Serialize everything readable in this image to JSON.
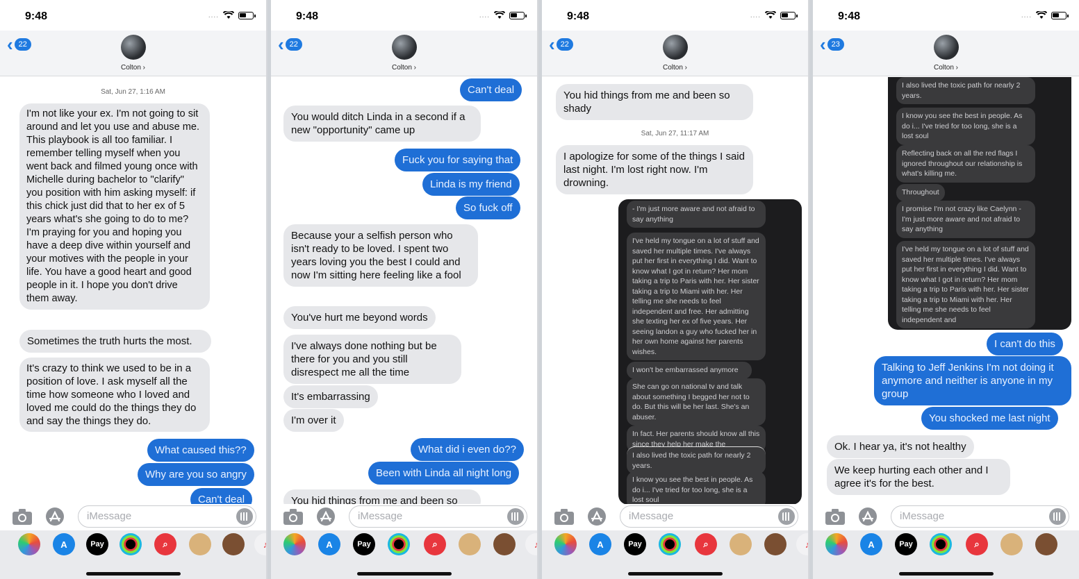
{
  "phones": [
    {
      "time": "9:48",
      "badge": "22",
      "contact": "Colton ›"
    },
    {
      "time": "9:48",
      "badge": "22",
      "contact": "Colton ›"
    },
    {
      "time": "9:48",
      "badge": "22",
      "contact": "Colton ›"
    },
    {
      "time": "9:48",
      "badge": "23",
      "contact": "Colton ›"
    }
  ],
  "input": {
    "placeholder": "iMessage"
  },
  "apps": {
    "pay": "Pay"
  },
  "status": {
    "dots": "...."
  },
  "p1": {
    "ts": "Sat, Jun 27, 1:16 AM",
    "m1": "I'm not like your ex. I'm not going to sit around and let you use and abuse me. This playbook is all too familiar. I remember telling myself when you went back and filmed young once with Michelle during bachelor to \"clarify\" you position with him asking myself: if this chick just did that to her ex of 5 years what's she going to do to me? I'm praying for you and hoping you have a deep dive within yourself and your motives with the people in your life. You have a good heart and good people in it. I hope you don't drive them away.",
    "m2": "Sometimes the truth hurts the most.",
    "m3": "It's crazy to think we used to be in a position of love. I ask myself all the time how someone who I loved and loved me could do the things they do and say the things they do.",
    "m4": "What caused this??",
    "m5": "Why are you so angry",
    "m6": "Can't deal"
  },
  "p2": {
    "m1": "Can't deal",
    "m2": "You would ditch Linda in a second if a new \"opportunity\" came up",
    "m3": "Fuck you for saying that",
    "m4": "Linda is my friend",
    "m5": "So fuck off",
    "m6": "Because your a selfish person who isn't ready to be loved. I spent two years loving you the best I could and now I'm sitting here feeling like a fool",
    "m7": "You've hurt me beyond words",
    "m8": "I've always done nothing but be there for you and you still disrespect me all the time",
    "m9": "It's embarrassing",
    "m10": "I'm over it",
    "m11": "What did i even do??",
    "m12": "Been with Linda all night long",
    "m13": "You hid things from me and been so"
  },
  "p3": {
    "m1": "You hid things from me and been so shady",
    "ts": "Sat, Jun 27, 11:17 AM",
    "m2": "I apologize for some of the things I said last night. I'm lost right now. I'm drowning.",
    "d1": "- I'm just more aware and not afraid to say anything",
    "d2": "I've held my tongue on a lot of stuff and saved her multiple times. I've always put her first in everything I did. Want to know what I got in return? Her mom taking a trip to Paris with her. Her sister taking a trip to Miami with her. Her telling me she needs to feel independent and free. Her admitting she texting her ex of five years. Her seeing landon a guy who fucked her in her own home against her parents wishes.",
    "d3": "I won't be embarrassed anymore",
    "d4": "She can go on national tv and talk about something I begged her not to do. But this will be her last. She's an abuser.",
    "d5": "In fact. Her parents should know all this since they help her make the",
    "d6": "I also lived the toxic path for nearly 2 years.",
    "d7": "I know you see the best in people. As do i... I've tried for too long, she is a lost soul"
  },
  "p4": {
    "d1": "I also lived the toxic path for nearly 2 years.",
    "d2": "I know you see the best in people. As do i... I've tried for too long, she is a lost soul",
    "d3": "Reflecting back on all the red flags I ignored throughout our relationship is what's killing me.",
    "d4": "Throughout",
    "d5": "I promise I'm not crazy like Caelynn - I'm just more aware and not afraid to say anything",
    "d6": "I've held my tongue on a lot of stuff and saved her multiple times. I've always put her first in everything I did. Want to know what I got in return? Her mom taking a trip to Paris with her. Her sister taking a trip to Miami with her. Her telling me she needs to feel independent and",
    "m1": "I can't do this",
    "m2": "Talking to Jeff Jenkins I'm not doing it anymore and neither is anyone in my group",
    "m3": "You shocked me last night",
    "m4": "Ok. I hear ya, it's not healthy",
    "m5": "We keep hurting each other and I agree it's for the best."
  }
}
